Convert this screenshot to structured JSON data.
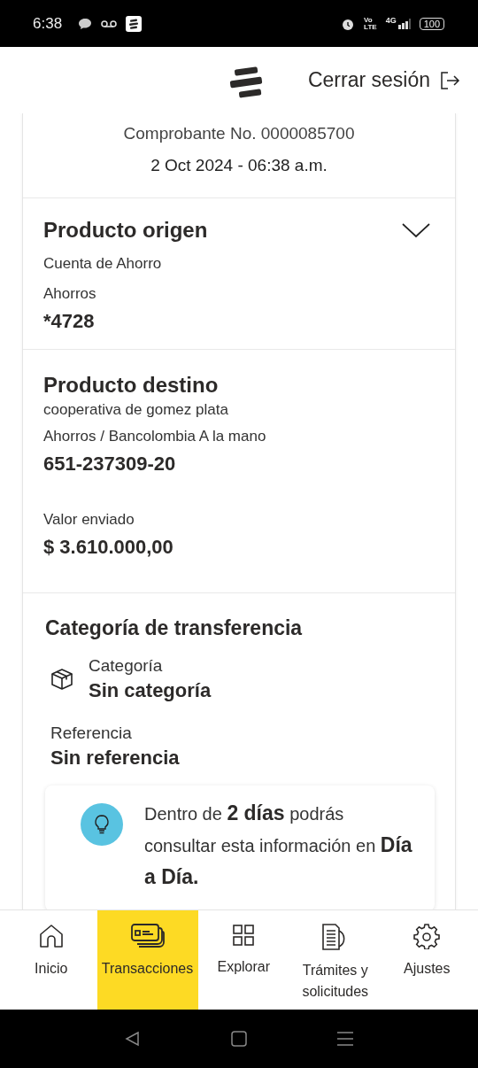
{
  "status_bar": {
    "time": "6:38",
    "volte": [
      "Vo",
      "LTE"
    ],
    "network": "4G",
    "battery": "100"
  },
  "header": {
    "logout": "Cerrar sesión"
  },
  "receipt": {
    "number": "Comprobante No. 0000085700",
    "date": "2 Oct 2024 - 06:38 a.m."
  },
  "origin": {
    "title": "Producto origen",
    "expanded": false,
    "type": "Cuenta de Ahorro",
    "subtype": "Ahorros",
    "account": "*4728"
  },
  "destination": {
    "title": "Producto destino",
    "name": "cooperativa de gomez plata",
    "type": "Ahorros / Bancolombia A la mano",
    "account": "651-237309-20",
    "amount_label": "Valor enviado",
    "amount": "$ 3.610.000,00"
  },
  "category": {
    "title": "Categoría de transferencia",
    "category_label": "Categoría",
    "category_value": "Sin categoría",
    "reference_label": "Referencia",
    "reference_value": "Sin referencia",
    "tip": "Dentro de **2 días** podrás consultar esta información en **Día a Día.**"
  },
  "nav": [
    {
      "label": "Inicio",
      "kind": "home",
      "selected": false
    },
    {
      "label": "Transacciones",
      "kind": "cards",
      "selected": true
    },
    {
      "label": "Explorar",
      "kind": "grid",
      "selected": false
    },
    {
      "label": "Trámites y solicitudes",
      "kind": "docs",
      "selected": false
    },
    {
      "label": "Ajustes",
      "kind": "gear",
      "selected": false
    }
  ]
}
